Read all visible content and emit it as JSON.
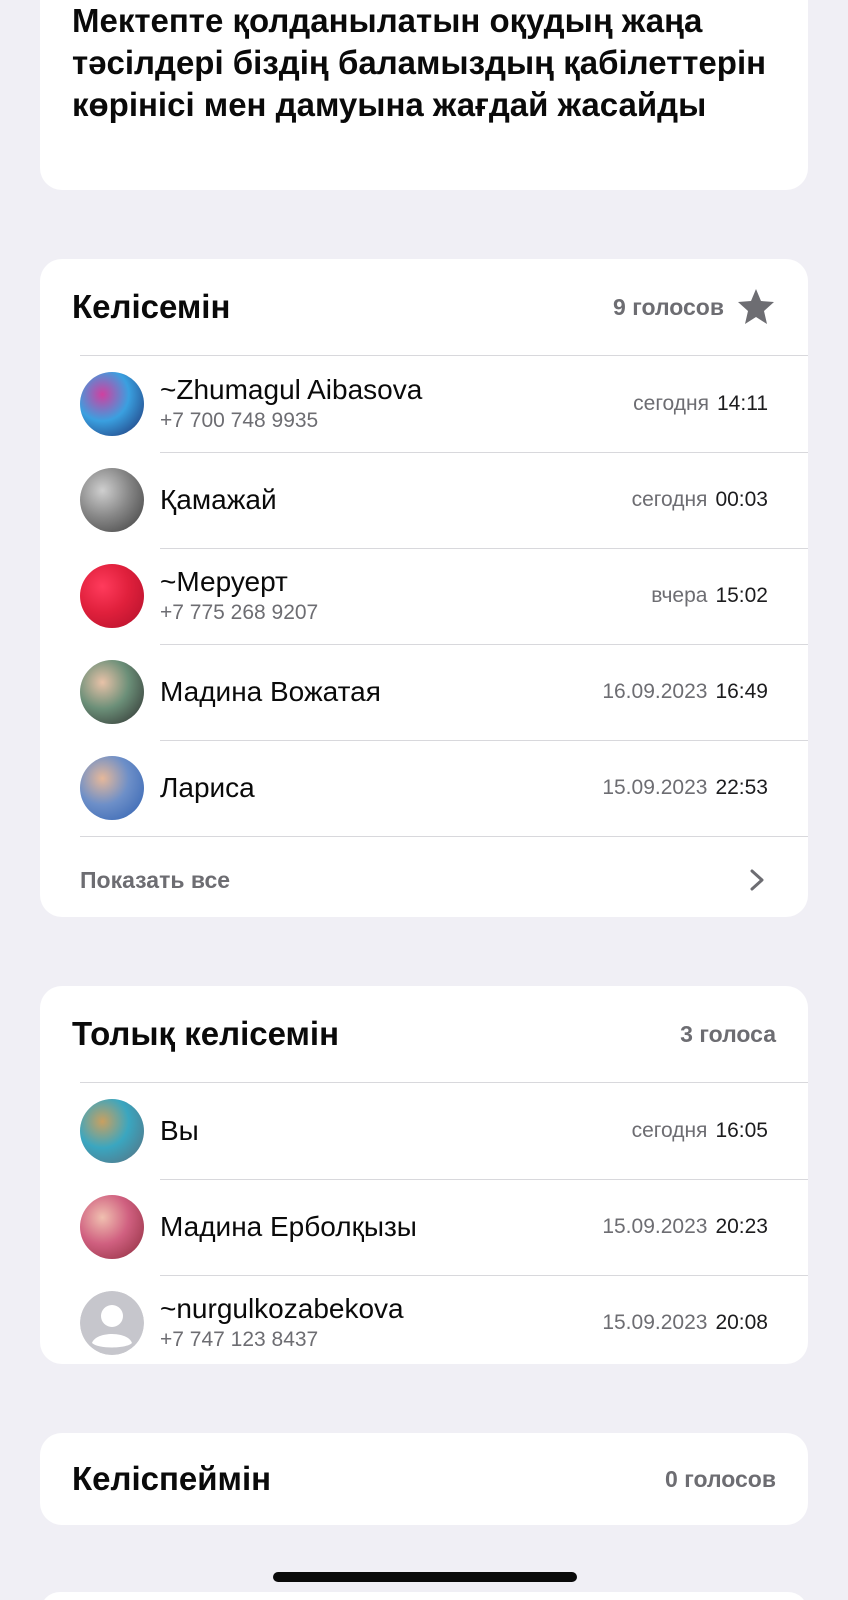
{
  "question": {
    "text": "Мектепте қолданылатын оқудың жаңа тәсілдері біздің баламыздың қабілеттерін көрінісі мен дамуына жағдай жасайды"
  },
  "options": [
    {
      "title": "Келісемін",
      "votes": "9 голосов",
      "starred": true,
      "voters": [
        {
          "name": "~Zhumagul Aibasova",
          "phone": "+7 700 748 9935",
          "date": "сегодня",
          "time": "14:11",
          "avatar_colors": [
            "#1c2a6b",
            "#d040a0",
            "#3aa0e0"
          ]
        },
        {
          "name": "Қамажай",
          "phone": "",
          "date": "сегодня",
          "time": "00:03",
          "avatar_colors": [
            "#3a3a3a",
            "#cfcfcf",
            "#888888"
          ]
        },
        {
          "name": "~Меруерт",
          "phone": "+7 775 268 9207",
          "date": "вчера",
          "time": "15:02",
          "avatar_colors": [
            "#b0102a",
            "#ff3b5c",
            "#e0203c"
          ]
        },
        {
          "name": "Мадина Вожатая",
          "phone": "",
          "date": "16.09.2023",
          "time": "16:49",
          "avatar_colors": [
            "#2b2b2b",
            "#e8c2a8",
            "#6b8f78"
          ]
        },
        {
          "name": "Лариса",
          "phone": "",
          "date": "15.09.2023",
          "time": "22:53",
          "avatar_colors": [
            "#2e5fb0",
            "#e6b89a",
            "#6d8fc8"
          ]
        }
      ],
      "show_all": "Показать все"
    },
    {
      "title": "Толық келісемін",
      "votes": "3 голоса",
      "starred": false,
      "voters": [
        {
          "name": "Вы",
          "phone": "",
          "date": "сегодня",
          "time": "16:05",
          "avatar_colors": [
            "#5a6b7a",
            "#c9a060",
            "#3aa6c0"
          ]
        },
        {
          "name": "Мадина Ерболқызы",
          "phone": "",
          "date": "15.09.2023",
          "time": "20:23",
          "avatar_colors": [
            "#8a2a3a",
            "#f0c0b0",
            "#d06080"
          ]
        },
        {
          "name": "~nurgulkozabekova",
          "phone": "+7 747 123 8437",
          "date": "15.09.2023",
          "time": "20:08",
          "avatar_colors": [
            "#c6c6cc",
            "#ffffff",
            "#b0b0b6"
          ]
        }
      ]
    },
    {
      "title": "Келіспеймін",
      "votes": "0 голосов",
      "starred": false,
      "voters": []
    }
  ]
}
